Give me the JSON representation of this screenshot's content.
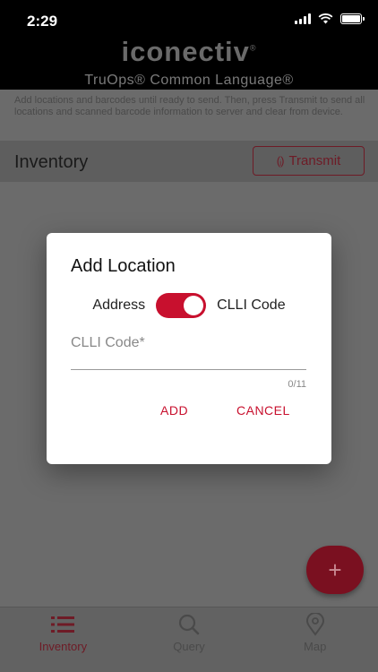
{
  "status_bar": {
    "time": "2:29"
  },
  "header": {
    "brand": "iconectiv",
    "subtitle": "TruOps® Common Language®"
  },
  "main": {
    "description": "Add locations and barcodes until ready to send. Then, press Transmit to send all locations and scanned barcode information to server and clear from device.",
    "section_title": "Inventory",
    "transmit_label": "Transmit",
    "fab_label": "+"
  },
  "dialog": {
    "title": "Add Location",
    "toggle_left_label": "Address",
    "toggle_right_label": "CLLI Code",
    "toggle_on": true,
    "field_label": "CLLI Code*",
    "char_counter": "0/11",
    "add_label": "ADD",
    "cancel_label": "CANCEL"
  },
  "bottom_nav": {
    "items": [
      {
        "label": "Inventory",
        "icon": "list-icon",
        "active": true
      },
      {
        "label": "Query",
        "icon": "search-icon",
        "active": false
      },
      {
        "label": "Map",
        "icon": "map-pin-icon",
        "active": false
      }
    ]
  },
  "colors": {
    "accent": "#c8102e",
    "scrim": "#6b6b6b"
  }
}
